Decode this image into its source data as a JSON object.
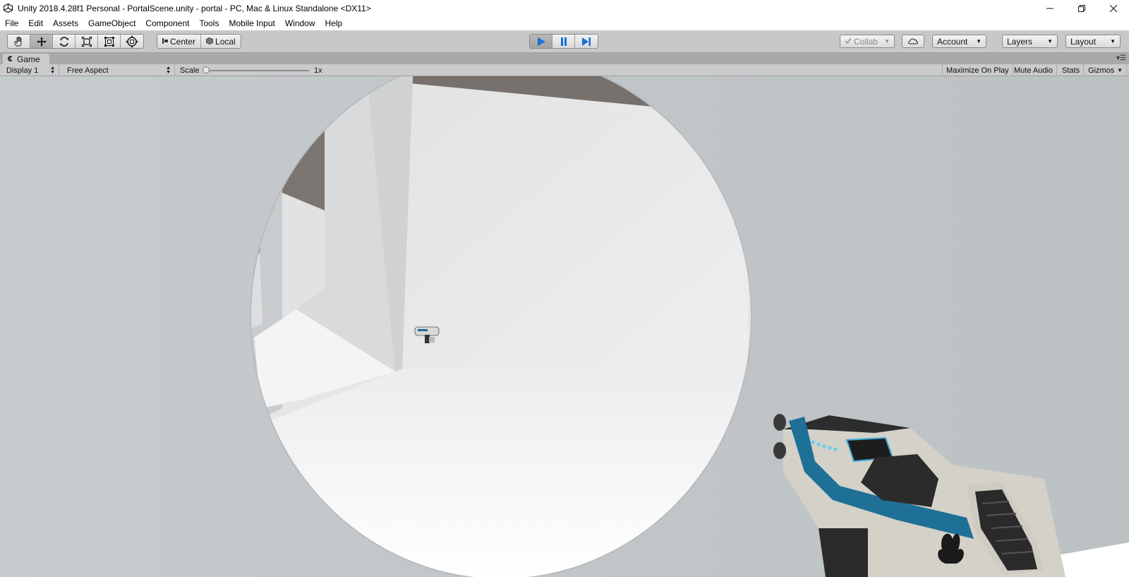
{
  "window": {
    "title": "Unity 2018.4.28f1 Personal - PortalScene.unity - portal - PC, Mac & Linux Standalone <DX11>",
    "minimize_icon": "minimize-icon",
    "restore_icon": "restore-icon",
    "close_icon": "close-icon"
  },
  "menu": {
    "items": [
      "File",
      "Edit",
      "Assets",
      "GameObject",
      "Component",
      "Tools",
      "Mobile Input",
      "Window",
      "Help"
    ]
  },
  "toolbar": {
    "transform_tools": [
      "hand-tool-icon",
      "move-tool-icon",
      "rotate-tool-icon",
      "scale-tool-icon",
      "rect-tool-icon",
      "transform-tool-icon"
    ],
    "pivot_mode": "Center",
    "pivot_rotation": "Local",
    "play_controls": [
      "play-icon",
      "pause-icon",
      "step-icon"
    ],
    "collab": "Collab",
    "account": "Account",
    "layers": "Layers",
    "layout": "Layout",
    "accent_color": "#1a6fd8"
  },
  "game_tab": {
    "label": "Game"
  },
  "game_toolbar": {
    "display": "Display 1",
    "aspect": "Free Aspect",
    "scale_label": "Scale",
    "scale_value": "1x",
    "maximize_on_play": "Maximize On Play",
    "mute_audio": "Mute Audio",
    "stats": "Stats",
    "gizmos": "Gizmos"
  }
}
